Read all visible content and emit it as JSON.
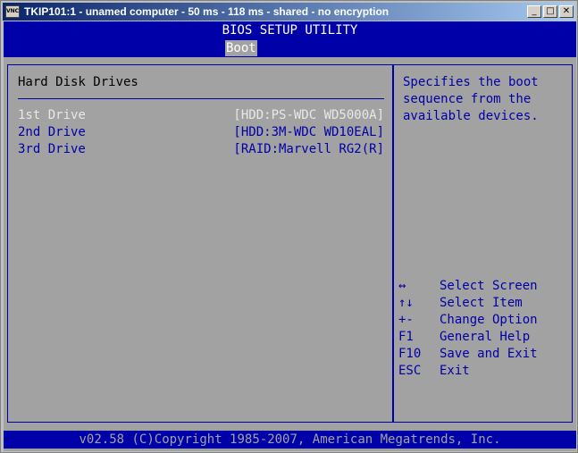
{
  "window": {
    "title": "TKIP101:1 - unamed computer - 50 ms - 118 ms - shared - no encryption",
    "icon_label": "VNC",
    "buttons": {
      "minimize": "_",
      "maximize": "□",
      "close": "✕"
    }
  },
  "bios": {
    "title": "BIOS SETUP UTILITY",
    "active_tab": "Boot",
    "section_title": "Hard Disk Drives",
    "drives": [
      {
        "label": "1st Drive",
        "value": "[HDD:PS-WDC WD5000A]",
        "selected": true
      },
      {
        "label": "2nd Drive",
        "value": "[HDD:3M-WDC WD10EAL]",
        "selected": false
      },
      {
        "label": "3rd Drive",
        "value": "[RAID:Marvell RG2(R]",
        "selected": false
      }
    ],
    "help_text": "Specifies the boot sequence from the available devices.",
    "keys": [
      {
        "key": "↔",
        "desc": "Select Screen"
      },
      {
        "key": "↑↓",
        "desc": "Select Item"
      },
      {
        "key": "+-",
        "desc": "Change Option"
      },
      {
        "key": "F1",
        "desc": "General Help"
      },
      {
        "key": "F10",
        "desc": "Save and Exit"
      },
      {
        "key": "ESC",
        "desc": "Exit"
      }
    ],
    "footer": "v02.58 (C)Copyright 1985-2007, American Megatrends, Inc."
  },
  "colors": {
    "bios_blue": "#0000a8",
    "bios_gray": "#a2a2a2",
    "selected_text": "#e8e8e8"
  }
}
